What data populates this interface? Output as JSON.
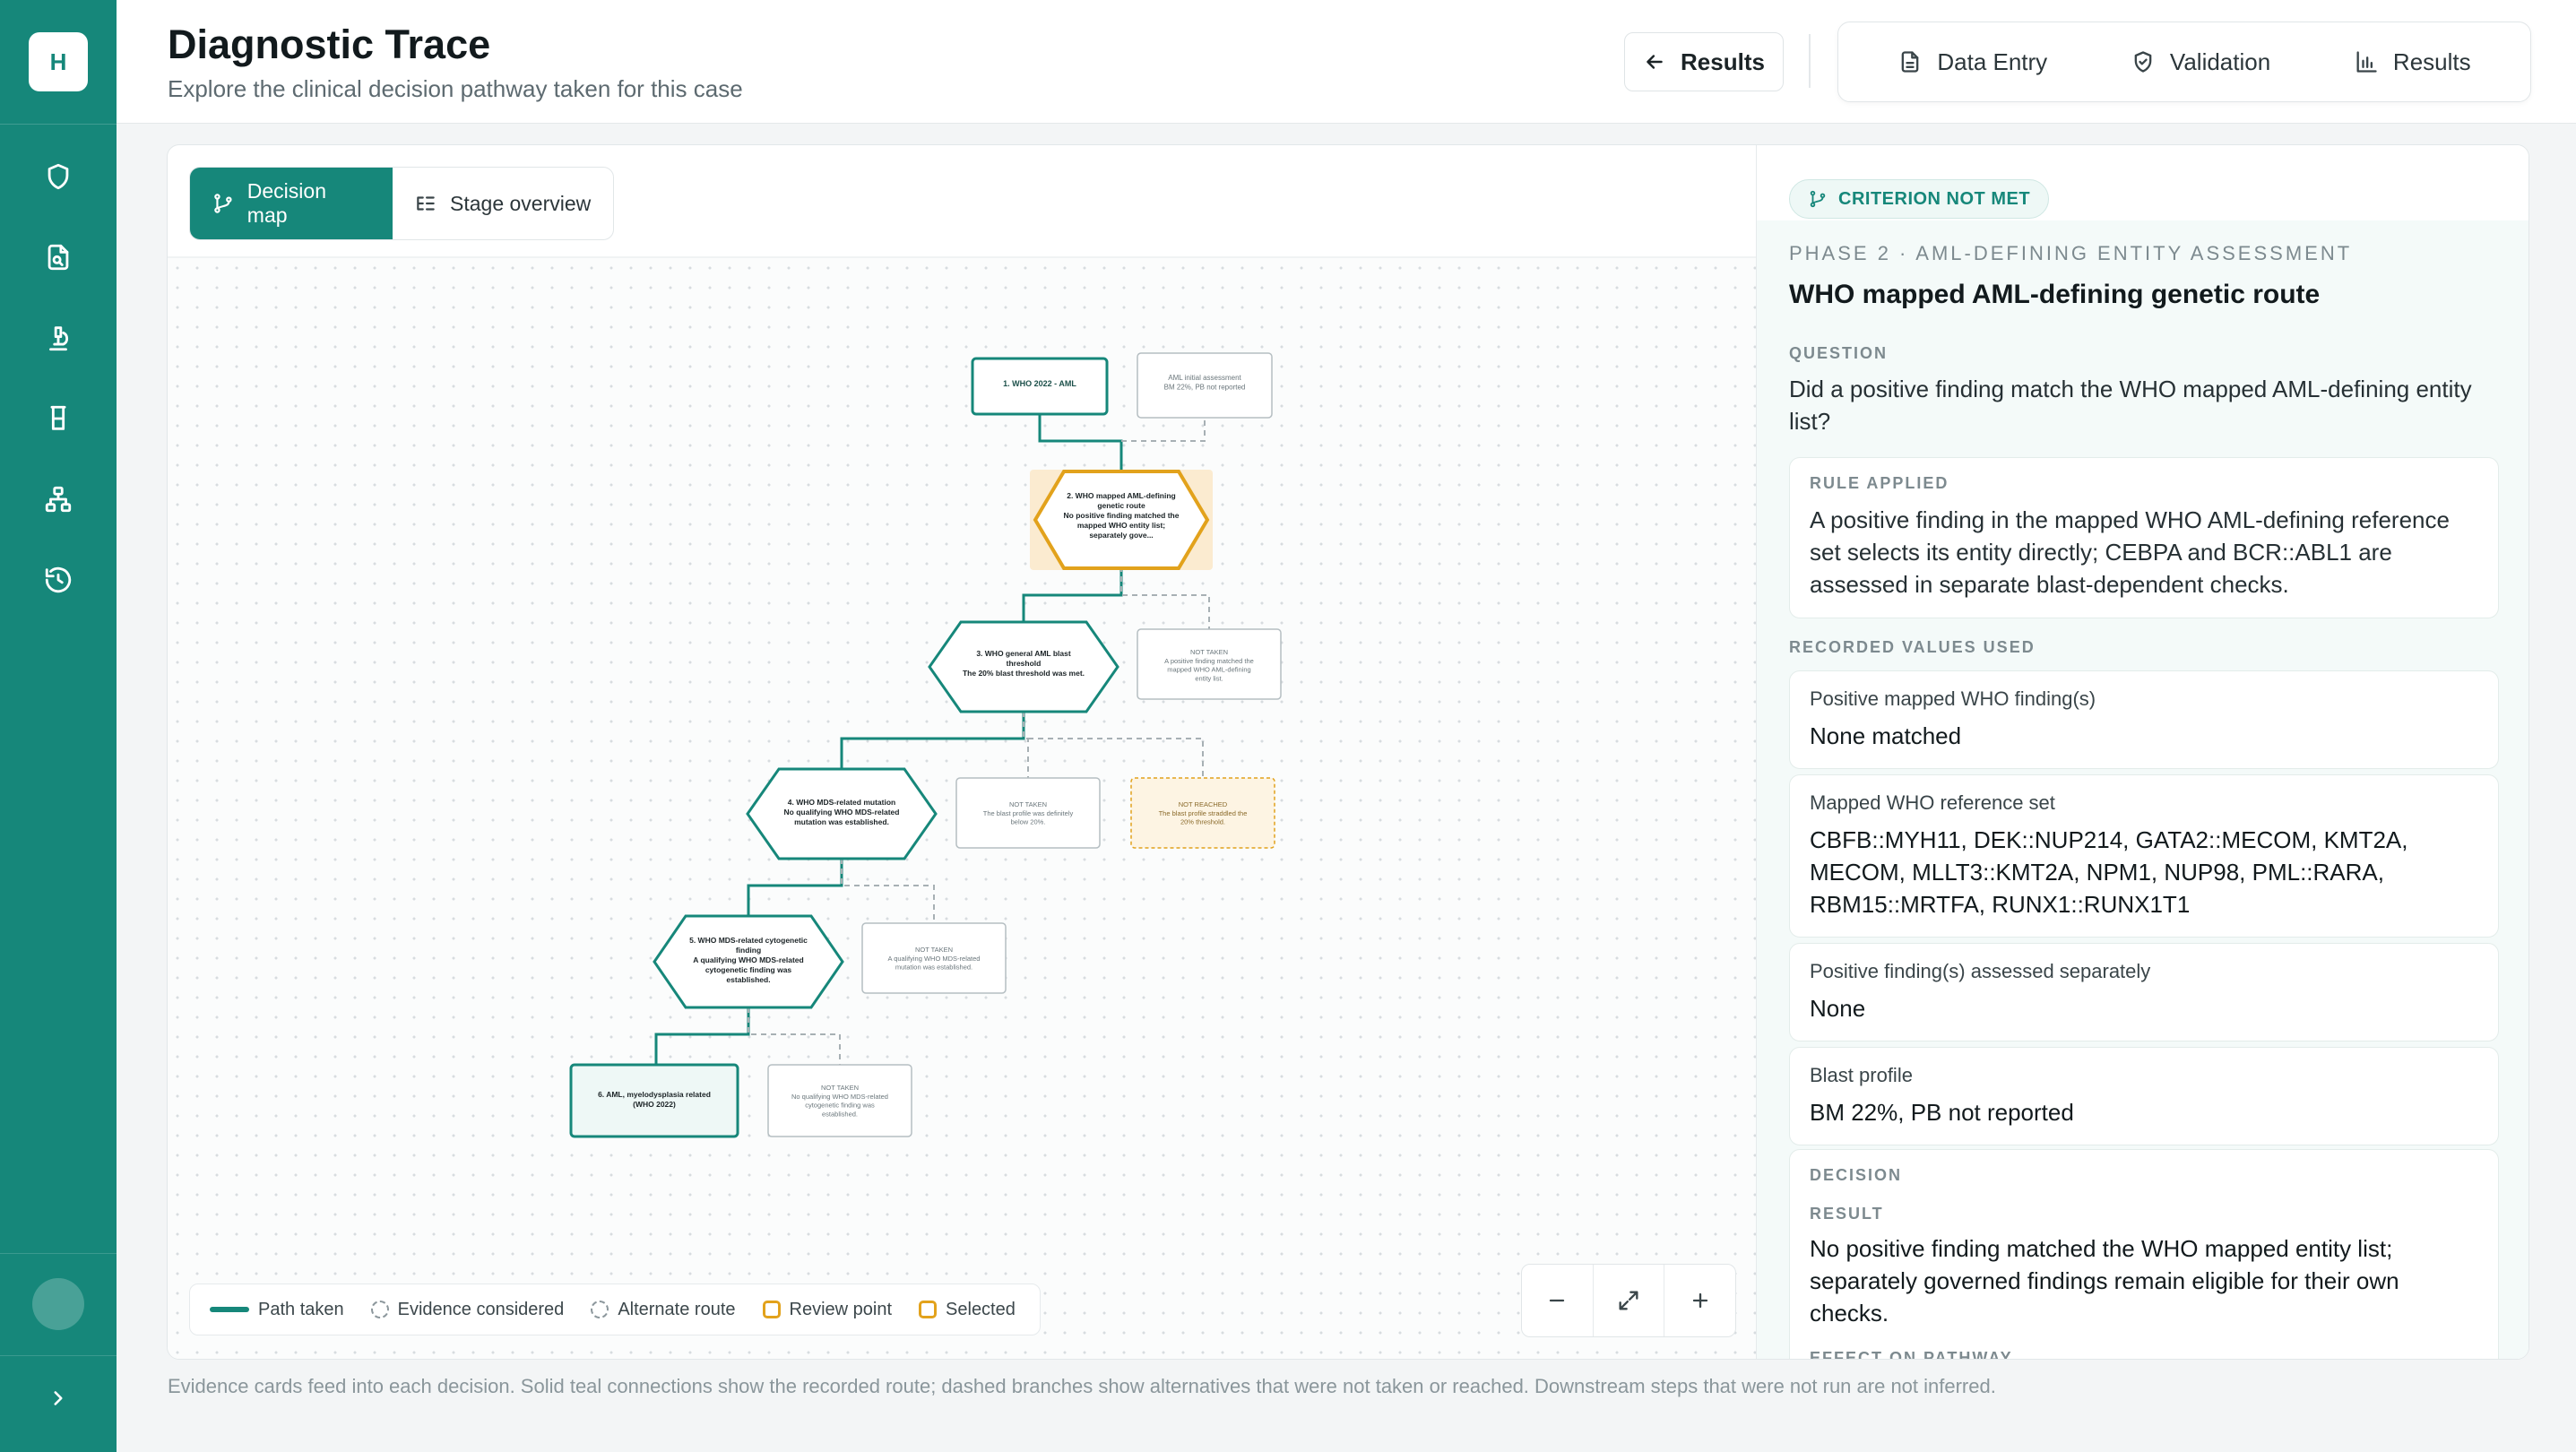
{
  "brand": {
    "letter": "H"
  },
  "header": {
    "title": "Diagnostic Trace",
    "subtitle": "Explore the clinical decision pathway taken for this case",
    "back_label": "Results",
    "steps": [
      {
        "label": "Data Entry",
        "icon": "document-icon"
      },
      {
        "label": "Validation",
        "icon": "shield-check-icon"
      },
      {
        "label": "Results",
        "icon": "bar-chart-icon"
      }
    ]
  },
  "tabs": [
    {
      "label": "Decision map",
      "active": true
    },
    {
      "label": "Stage overview",
      "active": false
    }
  ],
  "diagram": {
    "nodes": {
      "n1": {
        "lines": [
          "1. WHO 2022 - AML"
        ]
      },
      "n1e": {
        "lines": [
          "AML initial assessment",
          "BM 22%, PB not reported"
        ]
      },
      "n2": {
        "lines": [
          "2. WHO mapped AML-defining",
          "genetic route",
          "No positive finding matched the",
          "mapped WHO entity list;",
          "separately gove..."
        ]
      },
      "n3": {
        "lines": [
          "3. WHO general AML blast",
          "threshold",
          "The 20% blast threshold was met."
        ]
      },
      "n3alt": {
        "lines": [
          "NOT TAKEN",
          "A positive finding matched the",
          "mapped WHO AML-defining",
          "entity list."
        ]
      },
      "n4": {
        "lines": [
          "4. WHO MDS-related mutation",
          "No qualifying WHO MDS-related",
          "mutation was established."
        ]
      },
      "n4alt": {
        "lines": [
          "NOT TAKEN",
          "The blast profile was definitely",
          "below 20%."
        ]
      },
      "n4nr": {
        "lines": [
          "NOT REACHED",
          "The blast profile straddled the",
          "20% threshold."
        ]
      },
      "n5": {
        "lines": [
          "5. WHO MDS-related cytogenetic",
          "finding",
          "A qualifying WHO MDS-related",
          "cytogenetic finding was",
          "established."
        ]
      },
      "n5alt": {
        "lines": [
          "NOT TAKEN",
          "A qualifying WHO MDS-related",
          "mutation was established."
        ]
      },
      "n6": {
        "lines": [
          "6. AML, myelodysplasia related",
          "(WHO 2022)"
        ]
      },
      "n6alt": {
        "lines": [
          "NOT TAKEN",
          "No qualifying WHO MDS-related",
          "cytogenetic finding was",
          "established."
        ]
      }
    }
  },
  "legend": [
    {
      "label": "Path taken",
      "style": "solid"
    },
    {
      "label": "Evidence considered",
      "style": "dashed-circle"
    },
    {
      "label": "Alternate route",
      "style": "dashed-circle"
    },
    {
      "label": "Review point",
      "style": "square"
    },
    {
      "label": "Selected",
      "style": "square"
    }
  ],
  "panel": {
    "badge": "CRITERION NOT MET",
    "phase": "PHASE 2 · AML-DEFINING ENTITY ASSESSMENT",
    "title": "WHO mapped AML-defining genetic route",
    "question_label": "QUESTION",
    "question": "Did a positive finding match the WHO mapped AML-defining entity list?",
    "rule_label": "RULE APPLIED",
    "rule": "A positive finding in the mapped WHO AML-defining reference set selects its entity directly; CEBPA and BCR::ABL1 are assessed in separate blast-dependent checks.",
    "values_label": "RECORDED VALUES USED",
    "values": [
      {
        "key": "Positive mapped WHO finding(s)",
        "value": "None matched"
      },
      {
        "key": "Mapped WHO reference set",
        "value": "CBFB::MYH11, DEK::NUP214, GATA2::MECOM, KMT2A, MECOM, MLLT3::KMT2A, NPM1, NUP98, PML::RARA, RBM15::MRTFA, RUNX1::RUNX1T1"
      },
      {
        "key": "Positive finding(s) assessed separately",
        "value": "None"
      },
      {
        "key": "Blast profile",
        "value": "BM 22%, PB not reported"
      }
    ],
    "decision_label": "DECISION",
    "result_label": "RESULT",
    "result": "No positive finding matched the WHO mapped entity list; separately governed findings remain eligible for their own checks.",
    "effect_label": "EFFECT ON PATHWAY"
  },
  "footer_note": "Evidence cards feed into each decision. Solid teal connections show the recorded route; dashed branches show alternatives that were not taken or reached. Downstream steps that were not run are not inferred.",
  "colors": {
    "accent": "#16877a",
    "review": "#e2a21c",
    "rail": "#16877a"
  }
}
